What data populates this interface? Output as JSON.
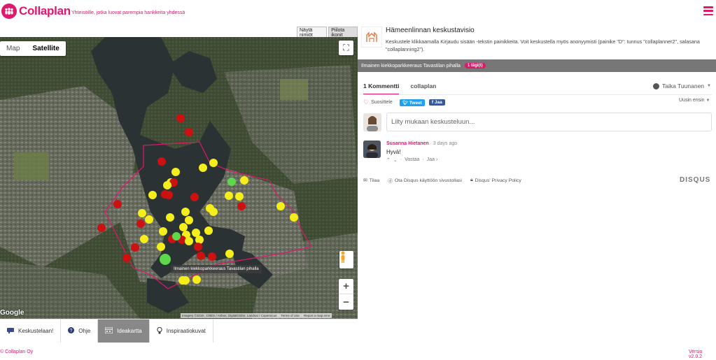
{
  "header": {
    "logo_text": "Collaplan",
    "tagline": "Yhteisöille, jotka luovat parempia hankkeita yhdessä"
  },
  "map": {
    "toggle_names": "Näytä nimiöt",
    "toggle_icons": "Piilota ikonit",
    "type_map": "Map",
    "type_satellite": "Satellite",
    "zoom_in": "+",
    "zoom_out": "−",
    "google": "Google",
    "attribution": "Imagery ©2019 , CNES / Airbus, DigitalGlobe, Landsat / Copernicus",
    "terms": "Terms of Use",
    "report": "Report a map error",
    "hover_label": "Ilmainen kiekkoparkkeeraus Tavastilan pihalla",
    "marker_colors": {
      "red": "#cc1111",
      "yellow": "#f5ee1a",
      "green": "#5cd84a"
    },
    "boundary_color": "#e0186c"
  },
  "bottom_tabs": [
    {
      "label": "Keskustelaan!",
      "icon": "flag-icon"
    },
    {
      "label": "Ohje",
      "icon": "help-icon"
    },
    {
      "label": "Ideakartta",
      "icon": "map-icon",
      "active": true
    },
    {
      "label": "Inspiraatiokuvat",
      "icon": "lightbulb-icon"
    }
  ],
  "footer": {
    "copyright": "© Collaplan Oy",
    "version": "Versio v2.0.2"
  },
  "panel": {
    "title": "Hämeenlinnan keskustavisio",
    "description": "Keskustele klikkaamalla Kirjaudu sisään -tekstin painikkeita. Voit keskustella myös anonyymisti (painike \"D\": tunnus \"collaplanner2\", salasana \"collaplanning2\").",
    "idea_title": "Ilmainen kiekkoparkkeeraus Tavastilan pihalla",
    "idea_badge": "1 tägi(t)"
  },
  "disqus": {
    "tab_comments": "1 Kommentti",
    "tab_community": "collaplan",
    "user": "Taika Tuunanen",
    "recommend": "Suosittele",
    "tweet": "Tweet",
    "share": "Jaa",
    "sort": "Uusin ensin",
    "placeholder": "Liity mukaan keskusteluun...",
    "comment": {
      "author": "Susanna Hietanen",
      "time": "· 3 days ago",
      "body": "Hyvä!",
      "reply": "Vastaa",
      "share": "Jaa ›"
    },
    "footer_subscribe": "Tilaa",
    "footer_add": "Ota Disqus käyttöön sivustollasi",
    "footer_privacy": "Disqus' Privacy Policy",
    "brand": "DISQUS"
  },
  "accent_color": "#e0186c"
}
